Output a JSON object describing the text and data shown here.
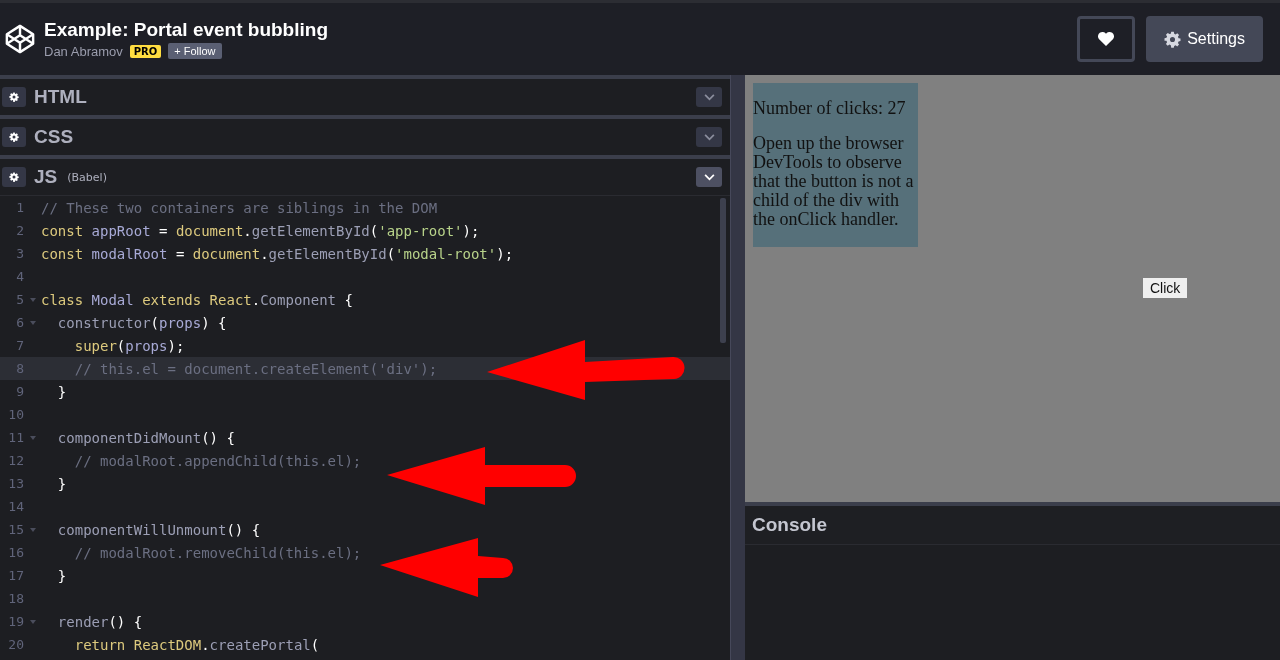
{
  "header": {
    "title": "Example: Portal event bubbling",
    "author": "Dan Abramov",
    "badge": "PRO",
    "follow_button": "+ Follow",
    "settings_button": "Settings"
  },
  "panels": [
    {
      "label": "HTML",
      "expanded": false
    },
    {
      "label": "CSS",
      "expanded": false
    },
    {
      "label": "JS",
      "note": "(Babel)",
      "expanded": true
    }
  ],
  "code_lines": [
    {
      "number": "1",
      "foldable": false,
      "highlighted": false,
      "tokens": [
        {
          "kind": "comment",
          "text": "// These two containers are siblings in the DOM"
        }
      ]
    },
    {
      "number": "2",
      "foldable": false,
      "highlighted": false,
      "tokens": [
        {
          "kind": "keyword",
          "text": "const"
        },
        {
          "kind": "variable",
          "text": " appRoot "
        },
        {
          "kind": "punct",
          "text": "= "
        },
        {
          "kind": "keyword",
          "text": "document"
        },
        {
          "kind": "punct",
          "text": "."
        },
        {
          "kind": "method",
          "text": "getElementById"
        },
        {
          "kind": "punct",
          "text": "("
        },
        {
          "kind": "string",
          "text": "'app-root'"
        },
        {
          "kind": "punct",
          "text": ");"
        }
      ]
    },
    {
      "number": "3",
      "foldable": false,
      "highlighted": false,
      "tokens": [
        {
          "kind": "keyword",
          "text": "const"
        },
        {
          "kind": "variable",
          "text": " modalRoot "
        },
        {
          "kind": "punct",
          "text": "= "
        },
        {
          "kind": "keyword",
          "text": "document"
        },
        {
          "kind": "punct",
          "text": "."
        },
        {
          "kind": "method",
          "text": "getElementById"
        },
        {
          "kind": "punct",
          "text": "("
        },
        {
          "kind": "string",
          "text": "'modal-root'"
        },
        {
          "kind": "punct",
          "text": ");"
        }
      ]
    },
    {
      "number": "4",
      "foldable": false,
      "highlighted": false
    },
    {
      "number": "5",
      "foldable": true,
      "highlighted": false,
      "tokens": [
        {
          "kind": "keyword",
          "text": "class"
        },
        {
          "kind": "variable",
          "text": " Modal "
        },
        {
          "kind": "keyword",
          "text": "extends React"
        },
        {
          "kind": "punct",
          "text": "."
        },
        {
          "kind": "method",
          "text": "Component "
        },
        {
          "kind": "punct",
          "text": "{"
        }
      ]
    },
    {
      "number": "6",
      "foldable": true,
      "highlighted": false,
      "tokens": [
        {
          "kind": "method",
          "text": "  constructor"
        },
        {
          "kind": "punct",
          "text": "("
        },
        {
          "kind": "variable",
          "text": "props"
        },
        {
          "kind": "punct",
          "text": ") {"
        }
      ]
    },
    {
      "number": "7",
      "foldable": false,
      "highlighted": false,
      "tokens": [
        {
          "kind": "keyword",
          "text": "    super"
        },
        {
          "kind": "punct",
          "text": "("
        },
        {
          "kind": "variable",
          "text": "props"
        },
        {
          "kind": "punct",
          "text": ");"
        }
      ]
    },
    {
      "number": "8",
      "foldable": false,
      "highlighted": true,
      "tokens": [
        {
          "kind": "comment",
          "text": "    // this.el = document.createElement('div');"
        }
      ]
    },
    {
      "number": "9",
      "foldable": false,
      "highlighted": false,
      "tokens": [
        {
          "kind": "punct",
          "text": "  }"
        }
      ]
    },
    {
      "number": "10",
      "foldable": false,
      "highlighted": false
    },
    {
      "number": "11",
      "foldable": true,
      "highlighted": false,
      "tokens": [
        {
          "kind": "method",
          "text": "  componentDidMount"
        },
        {
          "kind": "punct",
          "text": "() {"
        }
      ]
    },
    {
      "number": "12",
      "foldable": false,
      "highlighted": false,
      "tokens": [
        {
          "kind": "comment",
          "text": "    // modalRoot.appendChild(this.el);"
        }
      ]
    },
    {
      "number": "13",
      "foldable": false,
      "highlighted": false,
      "tokens": [
        {
          "kind": "punct",
          "text": "  }"
        }
      ]
    },
    {
      "number": "14",
      "foldable": false,
      "highlighted": false
    },
    {
      "number": "15",
      "foldable": true,
      "highlighted": false,
      "tokens": [
        {
          "kind": "method",
          "text": "  componentWillUnmount"
        },
        {
          "kind": "punct",
          "text": "() {"
        }
      ]
    },
    {
      "number": "16",
      "foldable": false,
      "highlighted": false,
      "tokens": [
        {
          "kind": "comment",
          "text": "    // modalRoot.removeChild(this.el);"
        }
      ]
    },
    {
      "number": "17",
      "foldable": false,
      "highlighted": false,
      "tokens": [
        {
          "kind": "punct",
          "text": "  }"
        }
      ]
    },
    {
      "number": "18",
      "foldable": false,
      "highlighted": false
    },
    {
      "number": "19",
      "foldable": true,
      "highlighted": false,
      "tokens": [
        {
          "kind": "method",
          "text": "  render"
        },
        {
          "kind": "punct",
          "text": "() {"
        }
      ]
    },
    {
      "number": "20",
      "foldable": false,
      "highlighted": false,
      "tokens": [
        {
          "kind": "keyword",
          "text": "    return ReactDOM"
        },
        {
          "kind": "punct",
          "text": "."
        },
        {
          "kind": "method",
          "text": "createPortal"
        },
        {
          "kind": "punct",
          "text": "("
        }
      ]
    }
  ],
  "preview": {
    "counter": "Number of clicks: 27",
    "description": "Open up the browser DevTools to observe that the button is not a child of the div with the onClick handler.",
    "button": "Click"
  },
  "console": {
    "title": "Console"
  }
}
